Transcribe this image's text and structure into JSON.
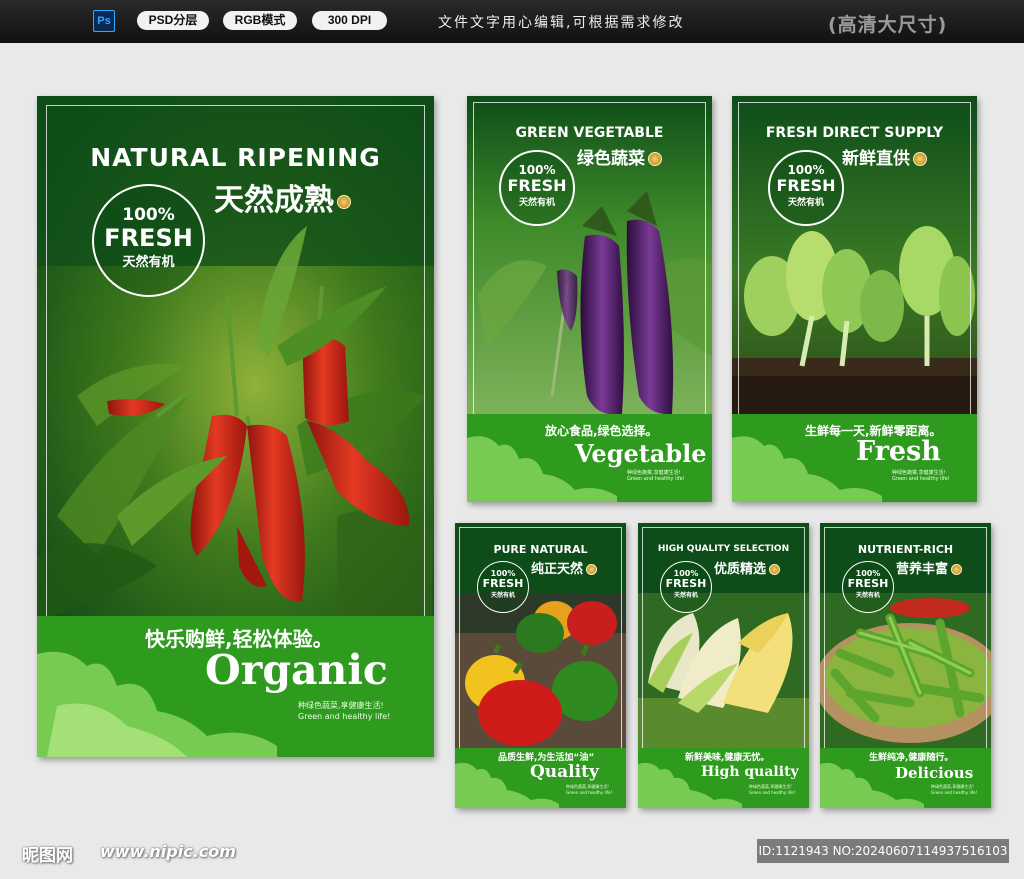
{
  "header": {
    "ps_label": "Ps",
    "tags": [
      "PSD分层",
      "RGB模式",
      "300 DPI"
    ],
    "note": "文件文字用心编辑,可根据需求修改",
    "hd_label": "(高清大尺寸)"
  },
  "posters": [
    {
      "en_title": "NATURAL RIPENING",
      "cn_title": "天然成熟",
      "badge_pct": "100%",
      "badge_fresh": "FRESH",
      "badge_cn": "天然有机",
      "slogan": "快乐购鲜,轻松体验。",
      "big": "Organic",
      "tiny1": "种绿色蔬菜,享健康生活!",
      "tiny2": "Green and healthy life!"
    },
    {
      "en_title": "GREEN VEGETABLE",
      "cn_title": "绿色蔬菜",
      "badge_pct": "100%",
      "badge_fresh": "FRESH",
      "badge_cn": "天然有机",
      "slogan": "放心食品,绿色选择。",
      "big": "Vegetable",
      "tiny1": "种绿色蔬菜,享健康生活!",
      "tiny2": "Green and healthy life!"
    },
    {
      "en_title": "FRESH DIRECT SUPPLY",
      "cn_title": "新鲜直供",
      "badge_pct": "100%",
      "badge_fresh": "FRESH",
      "badge_cn": "天然有机",
      "slogan": "生鲜每一天,新鲜零距离。",
      "big": "Fresh",
      "tiny1": "种绿色蔬菜,享健康生活!",
      "tiny2": "Green and healthy life!"
    },
    {
      "en_title": "PURE NATURAL",
      "cn_title": "纯正天然",
      "badge_pct": "100%",
      "badge_fresh": "FRESH",
      "badge_cn": "天然有机",
      "slogan": "品质生鲜,为生活加“油”",
      "big": "Quality",
      "tiny1": "种绿色蔬菜,享健康生活!",
      "tiny2": "Green and healthy life!"
    },
    {
      "en_title": "HIGH QUALITY SELECTION",
      "cn_title": "优质精选",
      "badge_pct": "100%",
      "badge_fresh": "FRESH",
      "badge_cn": "天然有机",
      "slogan": "新鲜美味,健康无忧。",
      "big": "High quality",
      "tiny1": "种绿色蔬菜,享健康生活!",
      "tiny2": "Green and healthy life!"
    },
    {
      "en_title": "NUTRIENT-RICH",
      "cn_title": "营养丰富",
      "badge_pct": "100%",
      "badge_fresh": "FRESH",
      "badge_cn": "天然有机",
      "slogan": "生鲜纯净,健康随行。",
      "big": "Delicious",
      "tiny1": "种绿色蔬菜,享健康生活!",
      "tiny2": "Green and healthy life!"
    }
  ],
  "footer": {
    "logo": "昵图网",
    "url": "www.nipic.com",
    "id_text": "ID:1121943 NO:20240607114937516103"
  },
  "colors": {
    "poster_green": "#1f7d1f",
    "band_green": "#2e9a1e",
    "pepper_red": "#c8231a",
    "eggplant": "#4b1f5e"
  }
}
